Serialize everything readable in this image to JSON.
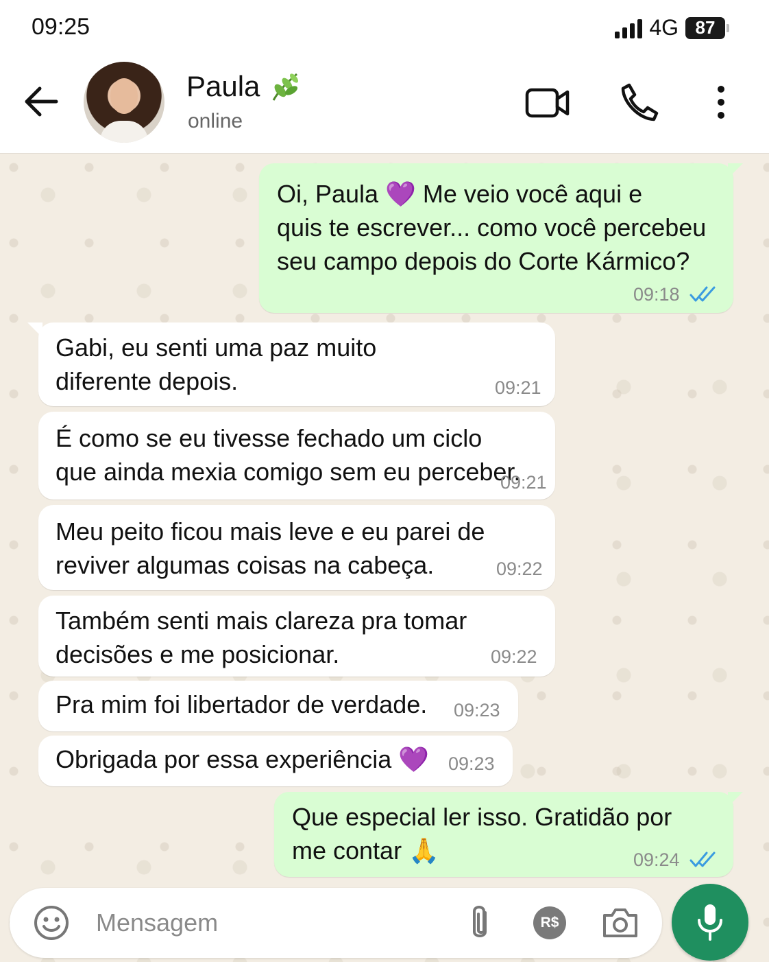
{
  "status_bar": {
    "time": "09:25",
    "network": "4G",
    "battery": "87"
  },
  "header": {
    "contact_name": "Paula",
    "contact_status": "online",
    "name_emoji_icon": "leaf-icon"
  },
  "messages": [
    {
      "direction": "out",
      "text": "Oi, Paula 💜  Me veio você aqui e\nquis te escrever... como você percebeu\nseu campo depois do Corte Kármico?",
      "time": "09:18",
      "read": true
    },
    {
      "direction": "in",
      "text": "Gabi, eu senti uma paz muito\ndiferente depois.",
      "time": "09:21"
    },
    {
      "direction": "in",
      "text": "É como se eu tivesse fechado um ciclo\nque ainda mexia comigo sem eu perceber.",
      "time": "09:21"
    },
    {
      "direction": "in",
      "text": "Meu peito ficou mais leve e eu parei de\nreviver algumas coisas na cabeça.",
      "time": "09:22"
    },
    {
      "direction": "in",
      "text": "Também senti mais clareza pra tomar\ndecisões e me posicionar.",
      "time": "09:22"
    },
    {
      "direction": "in",
      "text": "Pra mim foi libertador de verdade.",
      "time": "09:23"
    },
    {
      "direction": "in",
      "text": "Obrigada por essa experiência 💜",
      "time": "09:23"
    },
    {
      "direction": "out",
      "text": "Que especial ler isso. Gratidão por\nme contar 🙏",
      "time": "09:24",
      "read": true
    }
  ],
  "composer": {
    "placeholder": "Mensagem",
    "payment_label": "R$"
  },
  "colors": {
    "outgoing_bubble": "#d9fdd3",
    "incoming_bubble": "#ffffff",
    "chat_background": "#f3ede3",
    "mic_button": "#1f8f5f",
    "read_ticks": "#3a9be0"
  }
}
